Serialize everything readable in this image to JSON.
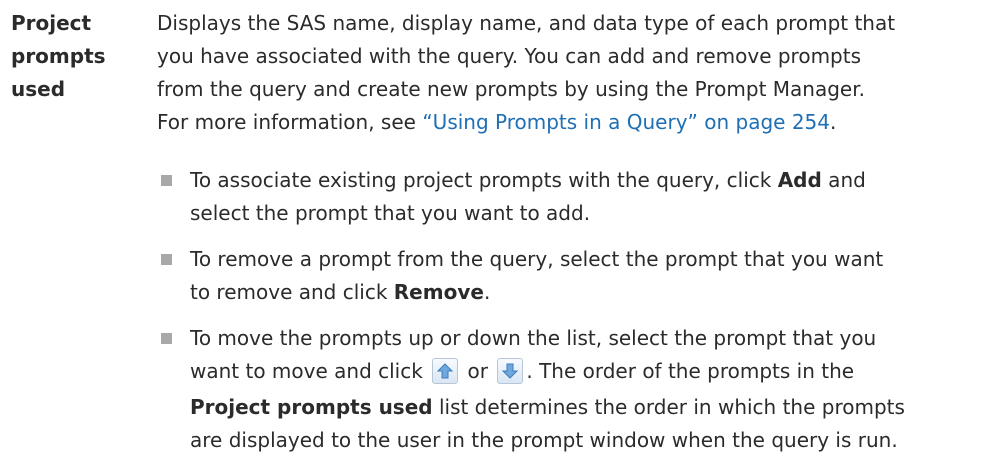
{
  "term": [
    "Project",
    "prompts",
    "used"
  ],
  "description": {
    "lines": [
      "Displays the SAS name, display name, and data type of each prompt that",
      "you have associated with the query. You can add and remove prompts",
      "from the query and create new prompts by using the Prompt Manager."
    ],
    "more_info_prefix": "For more information, see ",
    "more_info_link": "“Using Prompts in a Query” on page 254",
    "more_info_suffix": "."
  },
  "bullets": [
    {
      "line1_pre": "To associate existing project prompts with the query, click ",
      "line1_bold": "Add",
      "line1_post": " and",
      "line2": "select the prompt that you want to add."
    },
    {
      "line1": "To remove a prompt from the query, select the prompt that you want",
      "line2_pre": "to remove and click ",
      "line2_bold": "Remove",
      "line2_post": "."
    },
    {
      "line1": "To move the prompts up or down the list, select the prompt that you",
      "line2_pre": "want to move and click ",
      "line2_mid": " or ",
      "line2_post": ". The order of the prompts in the",
      "line3_bold": "Project prompts used",
      "line3_post": " list determines the order in which the prompts",
      "line4": "are displayed to the user in the prompt window when the query is run."
    }
  ],
  "icons": {
    "move_up": "arrow-up-icon",
    "move_down": "arrow-down-icon"
  },
  "colors": {
    "text": "#2b2b2b",
    "link": "#1f6fb5",
    "bullet": "#a8a8a8"
  }
}
